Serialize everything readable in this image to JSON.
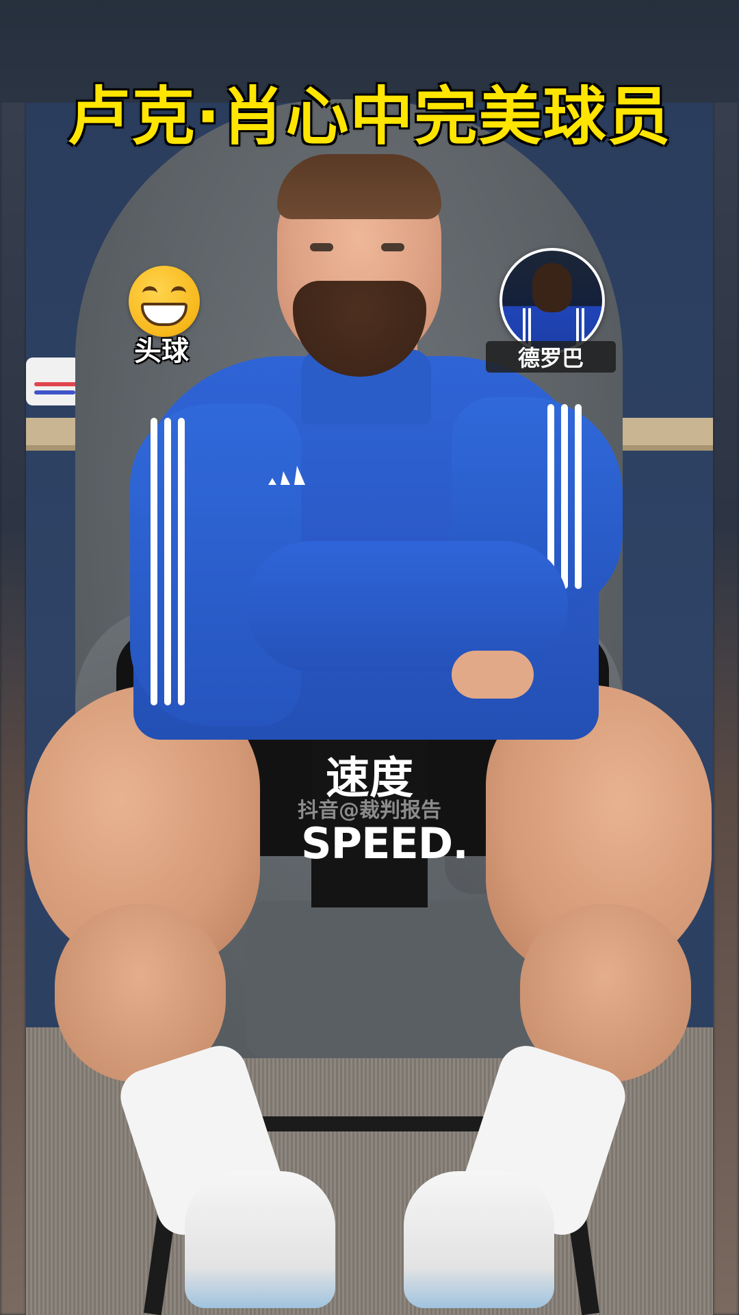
{
  "title": "卢克·肖心中完美球员",
  "emoji_badge": {
    "icon": "grinning-face-icon",
    "label": "头球"
  },
  "avatar_badge": {
    "label": "德罗巴"
  },
  "caption": {
    "chinese": "速度",
    "english": "SPEED."
  },
  "watermark": "抖音@裁判报告",
  "colors": {
    "title": "#ffe500",
    "jersey": "#2f64d6",
    "background": "#2b3d5d"
  }
}
